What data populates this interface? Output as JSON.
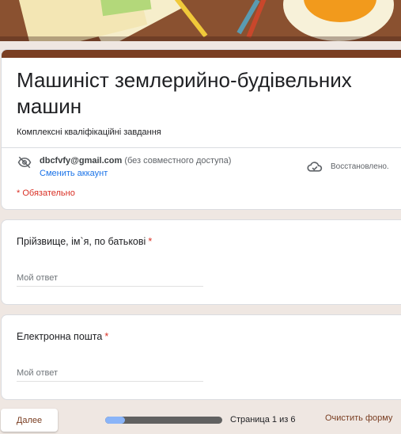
{
  "form": {
    "title": "Машиніст землерийно-будівельних машин",
    "description": "Комплексні кваліфікаційні завдання",
    "required_note": "* Обязательно"
  },
  "account": {
    "email": "dbcfvfy@gmail.com",
    "sharing_status": "(без совместного доступа)",
    "switch_label": "Сменить аккаунт",
    "save_status": "Восстановлено."
  },
  "questions": [
    {
      "label": "Прійзвище, ім`я, по батькові",
      "required_mark": "*",
      "placeholder": "Мой ответ"
    },
    {
      "label": "Електронна пошта",
      "required_mark": "*",
      "placeholder": "Мой ответ"
    }
  ],
  "footer": {
    "next_label": "Далее",
    "page_text": "Страница 1 из 6",
    "clear_label": "Очистить форму",
    "progress_fraction": 0.17
  },
  "colors": {
    "accent": "#7a3e22",
    "required": "#d93025",
    "link": "#1a73e8",
    "progress_fill": "#8ab4f8",
    "progress_track": "#616161"
  },
  "icons": {
    "account": "eye-off-icon",
    "save_status": "cloud-done-icon"
  }
}
